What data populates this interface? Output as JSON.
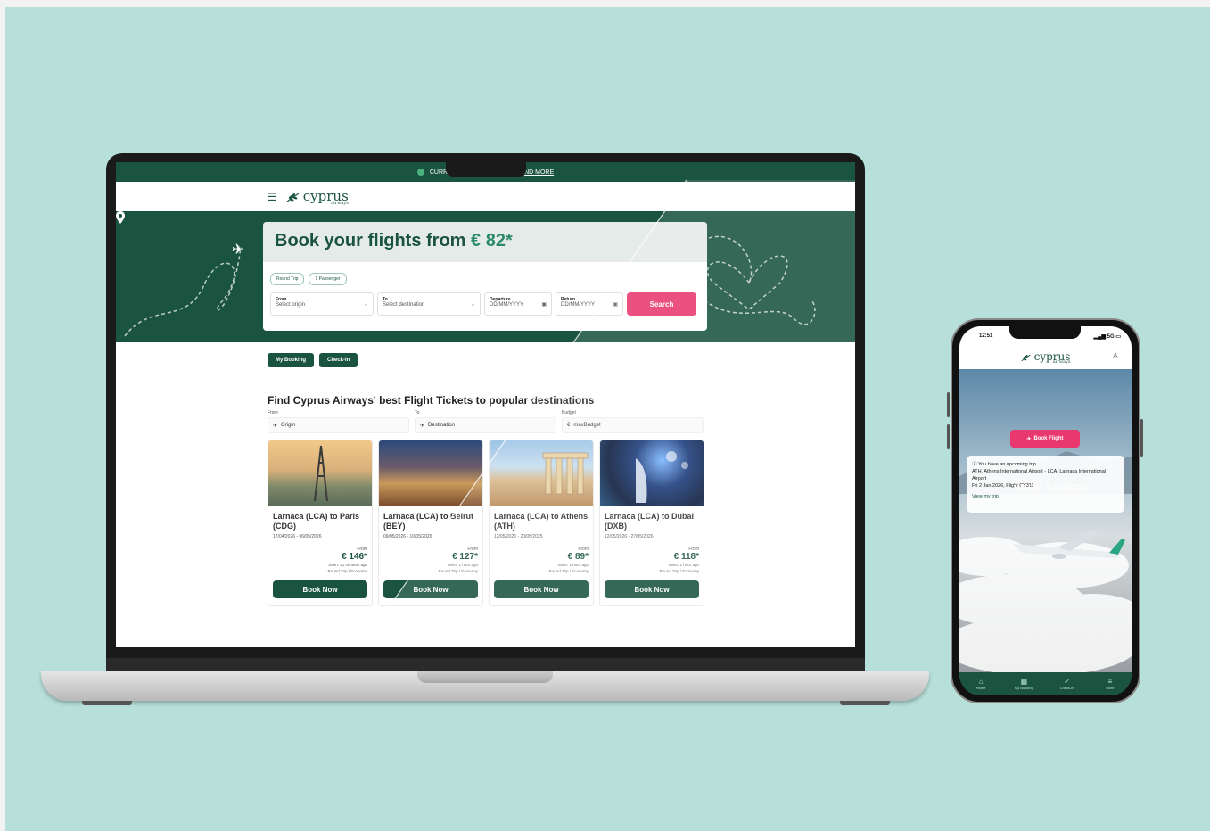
{
  "laptop": {
    "topbar": {
      "text_left": "CURR",
      "text_right": "ND MORE"
    },
    "logo": {
      "name": "cyprus",
      "tag": "airways"
    },
    "hero": {
      "title": "Book your flights from",
      "price": "€ 82*"
    },
    "search": {
      "trip_type": "Round Trip",
      "passengers": "1 Passenger",
      "from_label": "From",
      "from_value": "Select origin",
      "to_label": "To",
      "to_value": "Select destination",
      "departure_label": "Departure",
      "departure_value": "DD/MM/YYYY",
      "return_label": "Return",
      "return_value": "DD/MM/YYYY",
      "button": "Search"
    },
    "quick_links": [
      "My Booking",
      "Check-in"
    ],
    "section_title": "Find Cyprus Airways' best Flight Tickets to popular destinations",
    "filters": [
      {
        "label": "From",
        "value": "Origin"
      },
      {
        "label": "To",
        "value": "Destination"
      },
      {
        "label": "Budget",
        "value": "maxBudget"
      }
    ],
    "cards": [
      {
        "title": "Larnaca (LCA) to Paris (CDG)",
        "dates": "17/04/2026 - 06/05/2026",
        "from": "From",
        "price": "€ 146*",
        "seen": "Seen: 21 minutes ago",
        "type": "Round Trip / Economy",
        "button": "Book Now"
      },
      {
        "title": "Larnaca (LCA) to Beirut (BEY)",
        "dates": "09/05/2026 - 10/05/2026",
        "from": "From",
        "price": "€ 127*",
        "seen": "Seen: 1 hour ago",
        "type": "Round Trip / Economy",
        "button": "Book Now"
      },
      {
        "title": "Larnaca (LCA) to Athens (ATH)",
        "dates": "12/05/2025 - 20/05/2025",
        "from": "From",
        "price": "€ 89*",
        "seen": "Seen: 1 hour ago",
        "type": "Round Trip / Economy",
        "button": "Book Now"
      },
      {
        "title": "Larnaca (LCA) to Dubai (DXB)",
        "dates": "12/05/2026 - 27/05/2026",
        "from": "From",
        "price": "€ 118*",
        "seen": "Seen: 1 hour ago",
        "type": "Round Trip / Economy",
        "button": "Book Now"
      }
    ]
  },
  "phone": {
    "time": "12:51",
    "signal": "5G",
    "logo": {
      "name": "cyprus",
      "tag": "airways"
    },
    "book_button": "Book Flight",
    "trip": {
      "headline": "You have an upcoming trip",
      "route": "ATH, Athens International Airport - LCA, Larnaca International Airport",
      "detail": "Fri 2 Jan 2026, Flight CY311",
      "link": "View my trip"
    },
    "watermark": "YOUR SCREEN",
    "tabs": [
      "Home",
      "My Booking",
      "Check-in",
      "More"
    ]
  },
  "colors": {
    "brand_green": "#1a5440",
    "accent_pink": "#e8386f",
    "backdrop": "#b8e0da"
  }
}
